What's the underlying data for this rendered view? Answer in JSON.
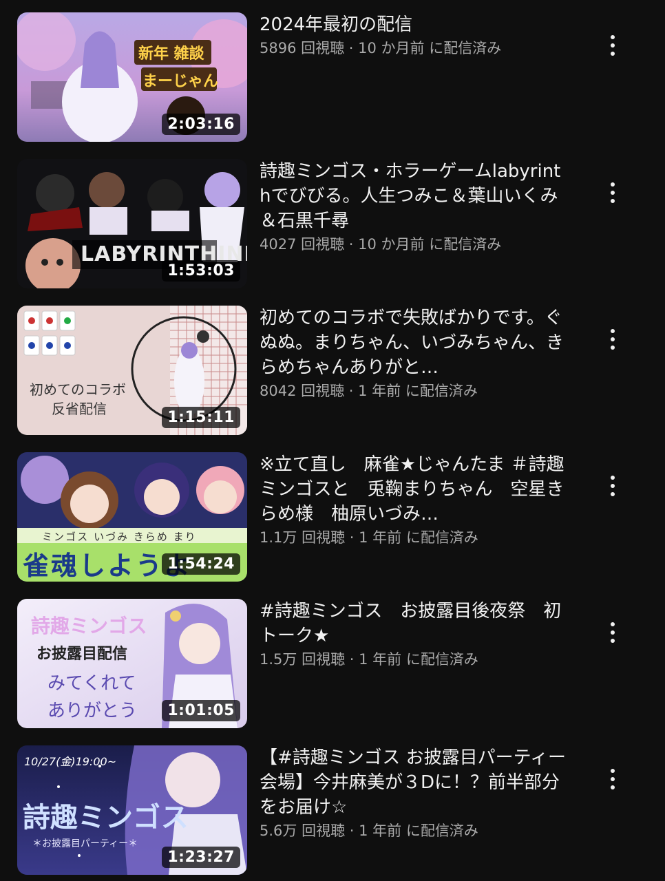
{
  "videos": [
    {
      "title": "2024年最初の配信",
      "views": "5896 回視聴",
      "age": "10 か月前",
      "status": "に配信済み",
      "duration": "2:03:16",
      "thumb_text": [
        "新年 雑談",
        "まーじゃん"
      ]
    },
    {
      "title": "詩趣ミンゴス・ホラーゲームlabyrinthでびびる。人生つみこ＆葉山いくみ＆石黒千尋",
      "views": "4027 回視聴",
      "age": "10 か月前",
      "status": "に配信済み",
      "duration": "1:53:03",
      "thumb_text": [
        "LABYRINTHINE"
      ]
    },
    {
      "title": "初めてのコラボで失敗ばかりです。ぐぬぬ。まりちゃん、いづみちゃん、きらめちゃんありがと…",
      "views": "8042 回視聴",
      "age": "1 年前",
      "status": "に配信済み",
      "duration": "1:15:11",
      "thumb_text": [
        "初めてのコラボ",
        "反省配信"
      ]
    },
    {
      "title": "※立て直し　麻雀★じゃんたま ＃詩趣ミンゴスと　兎鞠まりちゃん　空星きらめ様　柚原いづみ…",
      "views": "1.1万 回視聴",
      "age": "1 年前",
      "status": "に配信済み",
      "duration": "1:54:24",
      "thumb_text": [
        "ミンゴス いづみ きらめ まり",
        "雀魂しようよ"
      ]
    },
    {
      "title": "#詩趣ミンゴス　お披露目後夜祭　初トーク★",
      "views": "1.5万 回視聴",
      "age": "1 年前",
      "status": "に配信済み",
      "duration": "1:01:05",
      "thumb_text": [
        "詩趣ミンゴス",
        "お披露目配信",
        "みてくれて",
        "ありがとう"
      ]
    },
    {
      "title": "【#詩趣ミンゴス お披露目パーティー会場】今井麻美が３Dに！？前半部分をお届け☆",
      "views": "5.6万 回視聴",
      "age": "1 年前",
      "status": "に配信済み",
      "duration": "1:23:27",
      "thumb_text": [
        "10/27(金)19:00~",
        "詩趣ミンゴス",
        "＊お披露目パーティー＊"
      ]
    }
  ]
}
